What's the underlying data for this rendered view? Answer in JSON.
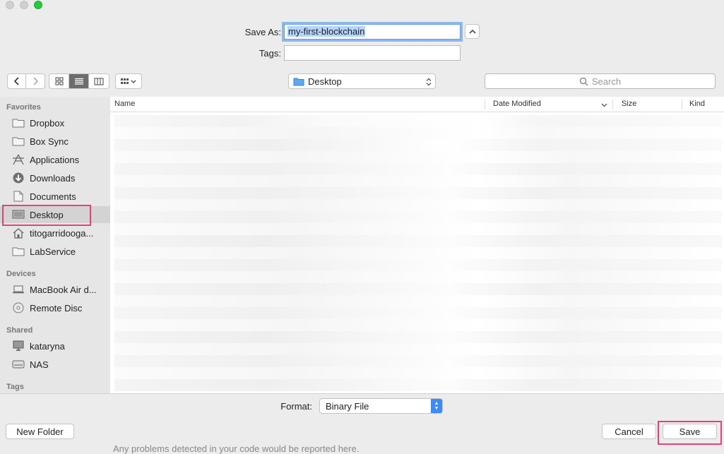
{
  "save_as": {
    "label": "Save As:",
    "value": "my-first-blockchain"
  },
  "tags": {
    "label": "Tags:",
    "value": ""
  },
  "location": {
    "value": "Desktop"
  },
  "search": {
    "placeholder": "Search"
  },
  "sidebar": {
    "favorites_title": "Favorites",
    "favorites": [
      {
        "label": "Dropbox",
        "icon": "folder-icon"
      },
      {
        "label": "Box Sync",
        "icon": "folder-icon"
      },
      {
        "label": "Applications",
        "icon": "applications-icon"
      },
      {
        "label": "Downloads",
        "icon": "downloads-icon"
      },
      {
        "label": "Documents",
        "icon": "documents-icon"
      },
      {
        "label": "Desktop",
        "icon": "desktop-icon"
      },
      {
        "label": "titogarridooga...",
        "icon": "home-icon"
      },
      {
        "label": "LabService",
        "icon": "folder-icon"
      }
    ],
    "devices_title": "Devices",
    "devices": [
      {
        "label": "MacBook Air d...",
        "icon": "laptop-icon"
      },
      {
        "label": "Remote Disc",
        "icon": "disc-icon"
      }
    ],
    "shared_title": "Shared",
    "shared": [
      {
        "label": "kataryna",
        "icon": "computer-icon"
      },
      {
        "label": "NAS",
        "icon": "nas-icon"
      }
    ],
    "tags_title": "Tags",
    "selected": "Desktop"
  },
  "columns": {
    "name": "Name",
    "date_modified": "Date Modified",
    "size": "Size",
    "kind": "Kind"
  },
  "format": {
    "label": "Format:",
    "value": "Binary File"
  },
  "buttons": {
    "new_folder": "New Folder",
    "cancel": "Cancel",
    "save": "Save"
  },
  "colors": {
    "accent": "#3c8cf5",
    "highlight": "#e8407a",
    "selection": "#b3d4fc"
  },
  "behind": {
    "text": "Any problems detected in your code would be reported here."
  }
}
